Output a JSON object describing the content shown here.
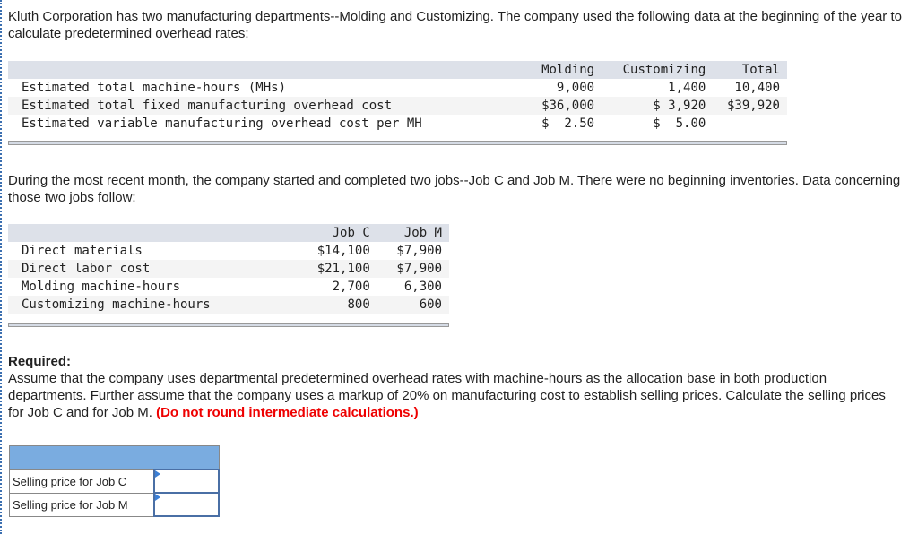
{
  "intro": "Kluth Corporation has two manufacturing departments--Molding and Customizing. The company used the following data at the beginning of the year to calculate predetermined overhead rates:",
  "overhead_table": {
    "headers": [
      "",
      "Molding",
      "Customizing",
      "Total"
    ],
    "rows": [
      {
        "label": "Estimated total machine-hours (MHs)",
        "molding": "9,000",
        "customizing": "1,400",
        "total": "10,400"
      },
      {
        "label": "Estimated total fixed manufacturing overhead cost",
        "molding": "$36,000",
        "customizing": "$ 3,920",
        "total": "$39,920"
      },
      {
        "label": "Estimated variable manufacturing overhead cost per MH",
        "molding": "$  2.50",
        "customizing": "$  5.00",
        "total": ""
      }
    ]
  },
  "jobs_intro": "During the most recent month, the company started and completed two jobs--Job C and Job M. There were no beginning inventories. Data concerning those two jobs follow:",
  "jobs_table": {
    "headers": [
      "",
      "Job C",
      "Job M"
    ],
    "rows": [
      {
        "label": "Direct materials",
        "job_c": "$14,100",
        "job_m": "$7,900"
      },
      {
        "label": "Direct labor cost",
        "job_c": "$21,100",
        "job_m": "$7,900"
      },
      {
        "label": "Molding machine-hours",
        "job_c": "2,700",
        "job_m": "6,300"
      },
      {
        "label": "Customizing machine-hours",
        "job_c": "800",
        "job_m": "600"
      }
    ]
  },
  "required": {
    "heading": "Required:",
    "text": "Assume that the company uses departmental predetermined overhead rates with machine-hours as the allocation base in both production departments. Further assume that the company uses a markup of 20% on manufacturing cost to establish selling prices. Calculate the selling prices for Job C and for Job M.",
    "note": "(Do not round intermediate calculations.)"
  },
  "answer_table": {
    "rows": [
      {
        "label": "Selling price for Job C",
        "value": ""
      },
      {
        "label": "Selling price for Job M",
        "value": ""
      }
    ]
  },
  "colors": {
    "header_bg": "#dde1e9",
    "answer_header_bg": "#7aace0",
    "note_red": "#e00000",
    "input_border": "#4a6fa5"
  }
}
